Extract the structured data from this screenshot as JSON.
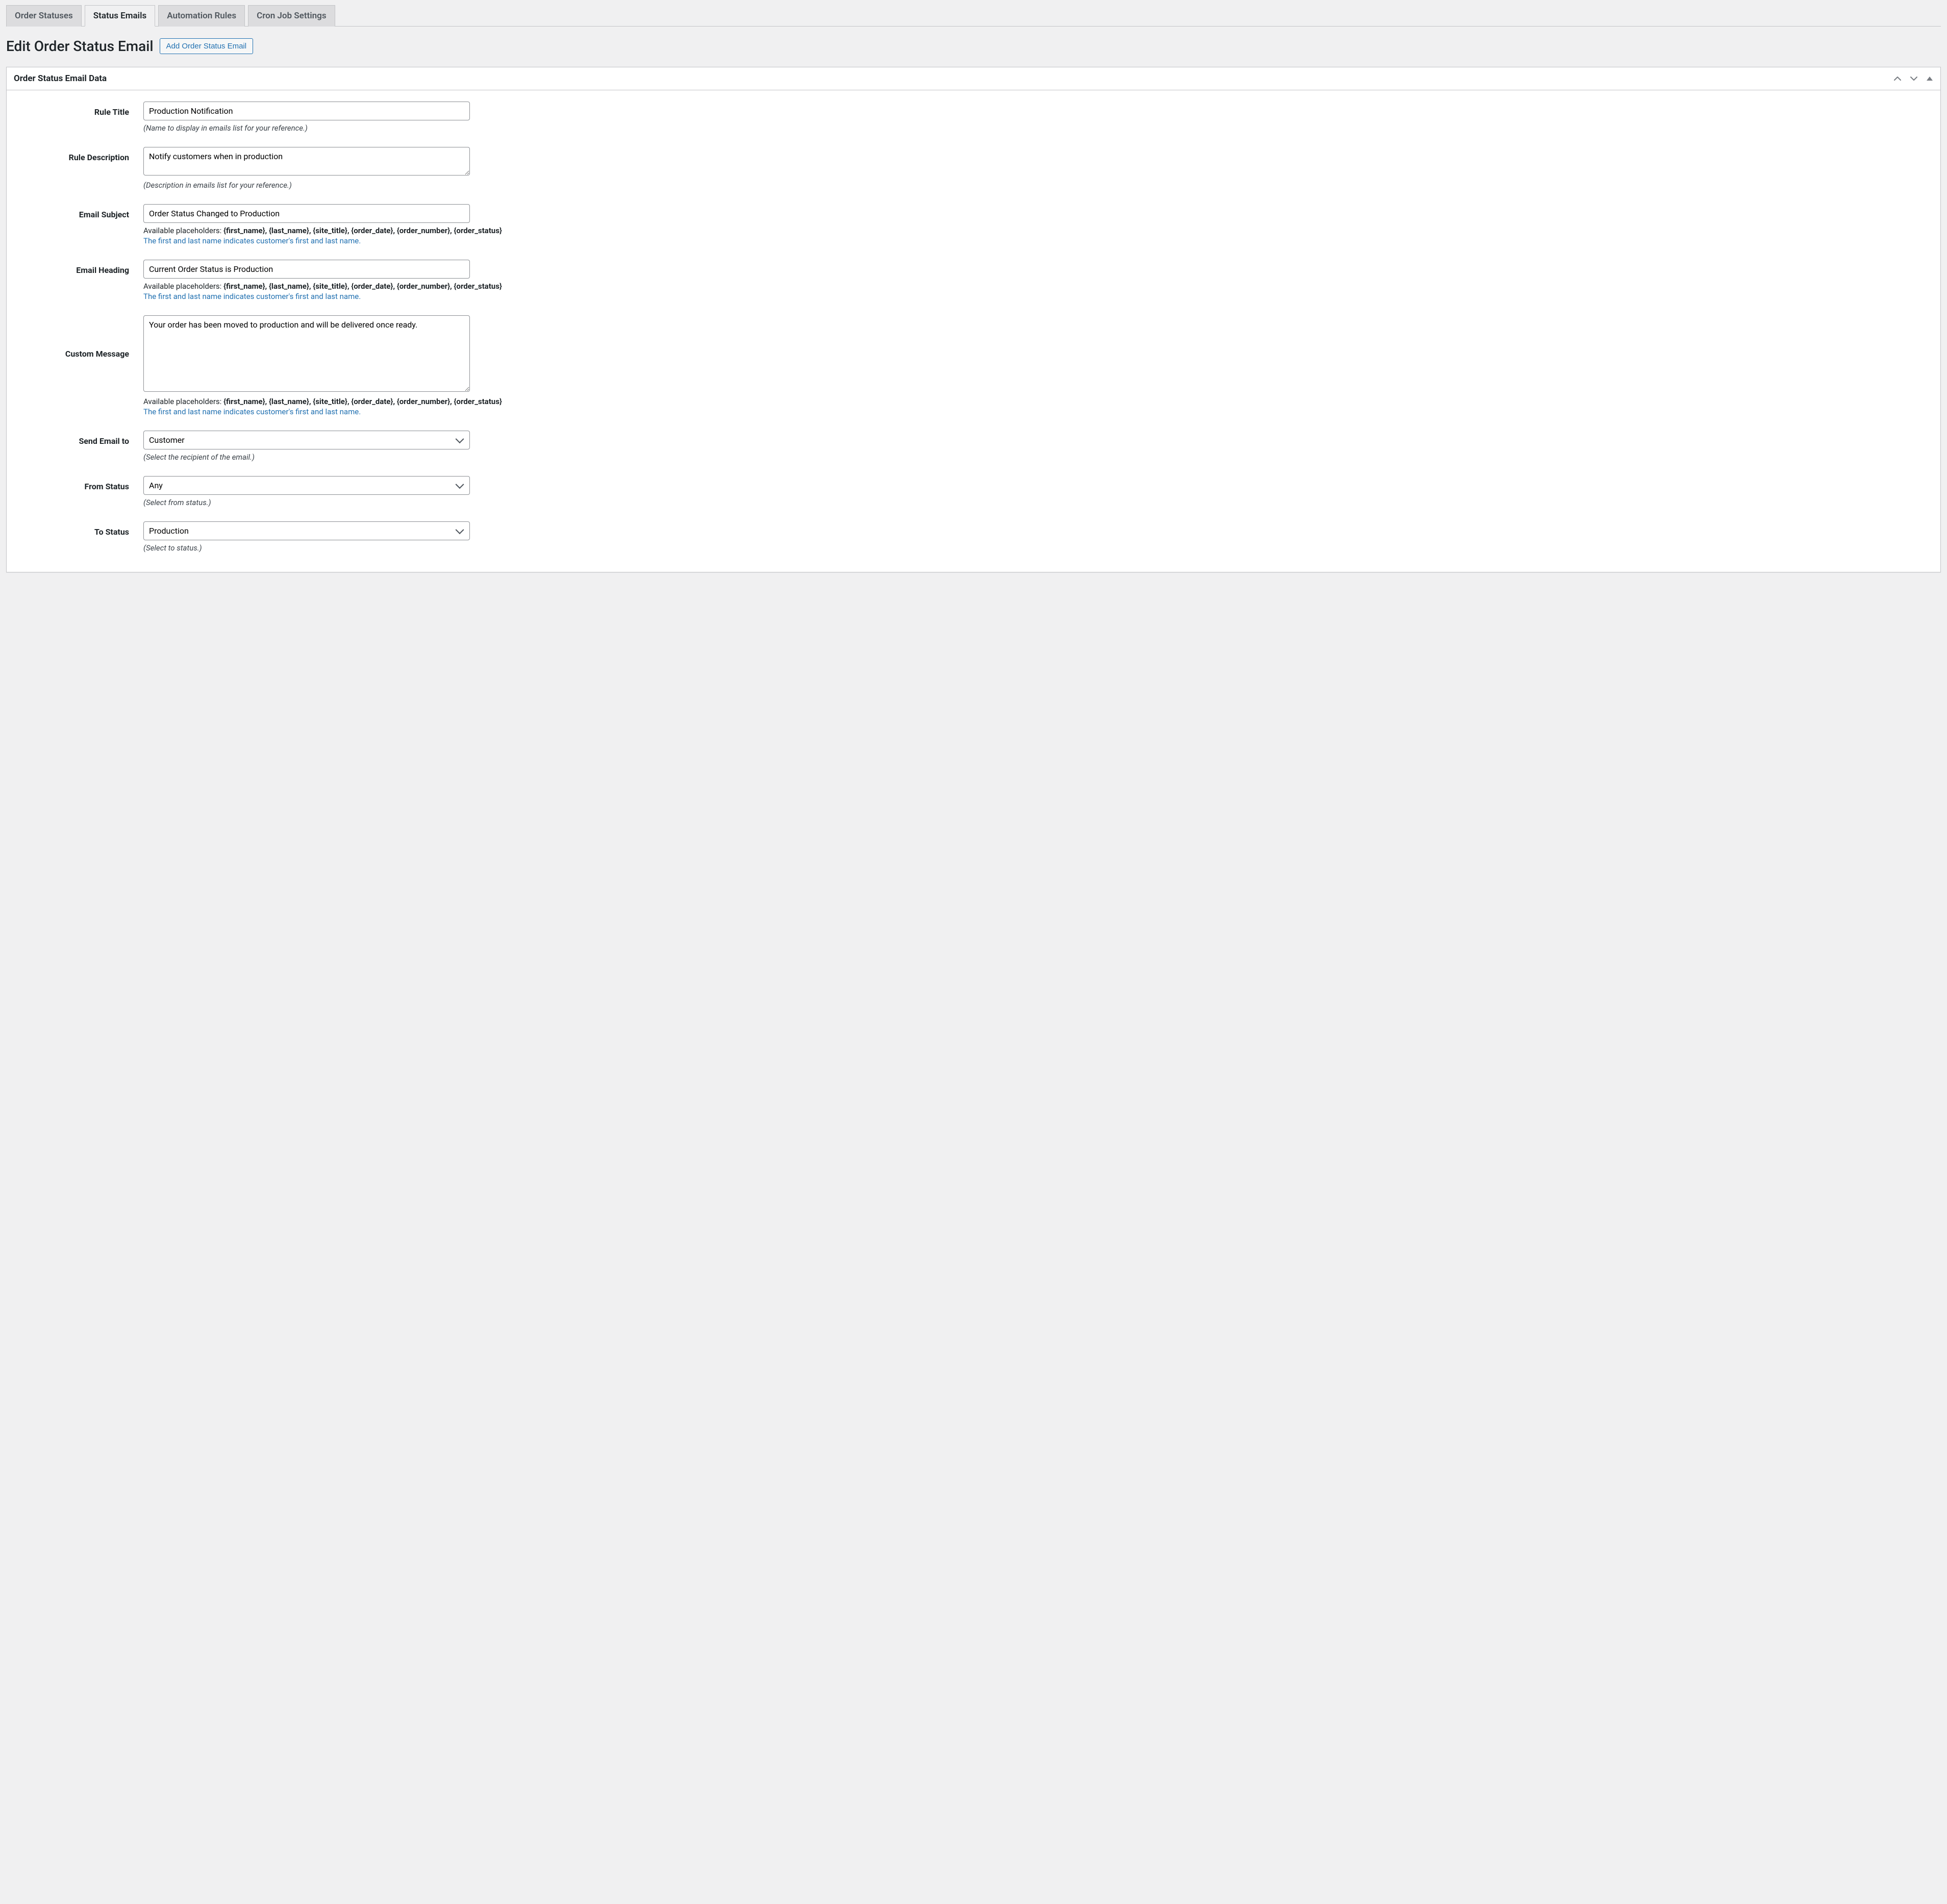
{
  "tabs": {
    "order_statuses": "Order Statuses",
    "status_emails": "Status Emails",
    "automation_rules": "Automation Rules",
    "cron_job_settings": "Cron Job Settings"
  },
  "heading": "Edit Order Status Email",
  "add_button": "Add Order Status Email",
  "panel_title": "Order Status Email Data",
  "labels": {
    "rule_title": "Rule Title",
    "rule_description": "Rule Description",
    "email_subject": "Email Subject",
    "email_heading": "Email Heading",
    "custom_message": "Custom Message",
    "send_email_to": "Send Email to",
    "from_status": "From Status",
    "to_status": "To Status"
  },
  "values": {
    "rule_title": "Production Notification",
    "rule_description": "Notify customers when in production",
    "email_subject": "Order Status Changed to Production",
    "email_heading": "Current Order Status is Production",
    "custom_message": "Your order has been moved to production and will be delivered once ready.",
    "send_email_to": "Customer",
    "from_status": "Any",
    "to_status": "Production"
  },
  "hints": {
    "rule_title": "(Name to display in emails list for your reference.)",
    "rule_description": "(Description in emails list for your reference.)",
    "placeholders_prefix": "Available placeholders: ",
    "placeholders_bold": "{first_name}, {last_name}, {site_title}, {order_date}, {order_number}, {order_status}",
    "placeholders_note": "The first and last name indicates customer's first and last name.",
    "send_email_to": "(Select the recipient of the email.)",
    "from_status": "(Select from status.)",
    "to_status": "(Select to status.)"
  }
}
